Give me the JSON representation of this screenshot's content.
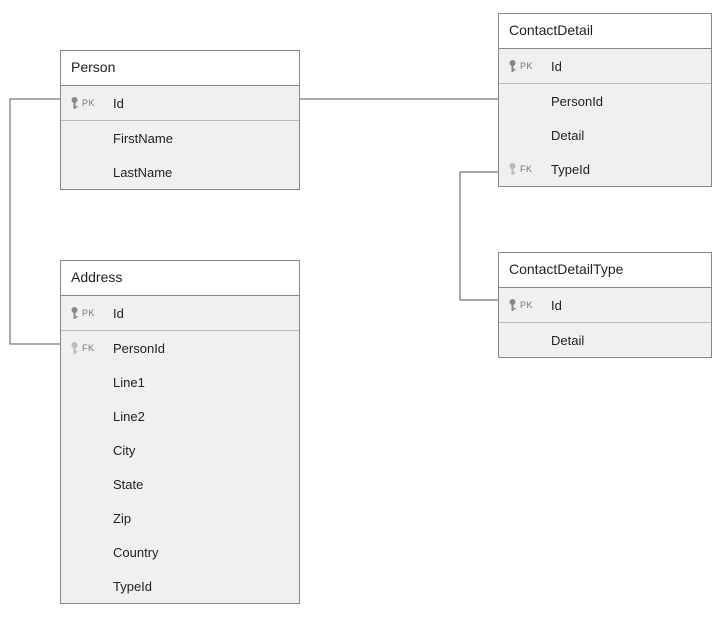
{
  "entities": {
    "person": {
      "title": "Person",
      "fields": [
        "Id",
        "FirstName",
        "LastName"
      ]
    },
    "contactDetail": {
      "title": "ContactDetail",
      "fields": [
        "Id",
        "PersonId",
        "Detail",
        "TypeId"
      ]
    },
    "address": {
      "title": "Address",
      "fields": [
        "Id",
        "PersonId",
        "Line1",
        "Line2",
        "City",
        "State",
        "Zip",
        "Country",
        "TypeId"
      ]
    },
    "contactDetailType": {
      "title": "ContactDetailType",
      "fields": [
        "Id",
        "Detail"
      ]
    }
  },
  "keyLabels": {
    "pk": "PK",
    "fk": "FK"
  }
}
